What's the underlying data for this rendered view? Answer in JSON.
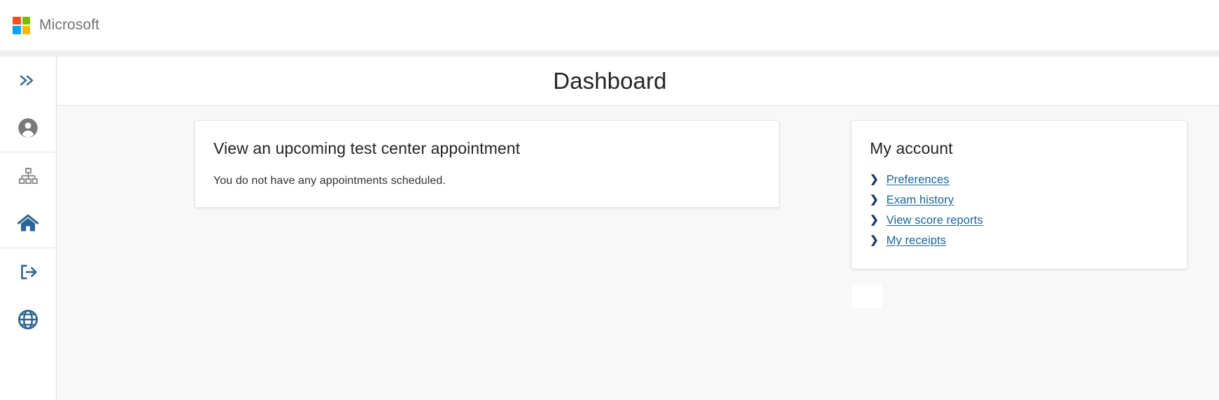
{
  "brand": {
    "name": "Microsoft",
    "logo_icon": "microsoft-squares-icon",
    "colors": {
      "red": "#f25022",
      "green": "#7fba00",
      "blue": "#00a4ef",
      "yellow": "#ffb900"
    }
  },
  "sidebar": {
    "items": [
      {
        "label": "Expand navigation",
        "icon": "double-chevron-right-icon",
        "color": "#2a6496",
        "active": false
      },
      {
        "label": "My account",
        "icon": "person-circle-icon",
        "color": "#7a7a7a",
        "active": false
      },
      {
        "label": "Organization",
        "icon": "org-chart-icon",
        "color": "#7a7a7a",
        "active": false
      },
      {
        "label": "Dashboard home",
        "icon": "home-icon",
        "color": "#2a6496",
        "active": true
      },
      {
        "label": "Sign out",
        "icon": "sign-out-icon",
        "color": "#2a6496",
        "active": false
      },
      {
        "label": "Language",
        "icon": "globe-icon",
        "color": "#2a6496",
        "active": false
      }
    ]
  },
  "header": {
    "title": "Dashboard"
  },
  "main": {
    "appointment_card": {
      "title": "View an upcoming test center appointment",
      "body": "You do not have any appointments scheduled."
    },
    "account_card": {
      "title": "My account",
      "chevron_icon": "chevron-right-icon",
      "links": [
        {
          "label": "Preferences"
        },
        {
          "label": "Exam history"
        },
        {
          "label": "View score reports"
        },
        {
          "label": "My receipts"
        }
      ]
    }
  },
  "theme": {
    "link_color": "#186699",
    "accent_color": "#2a6496",
    "page_bg": "#f8f8f8",
    "card_bg": "#ffffff"
  }
}
